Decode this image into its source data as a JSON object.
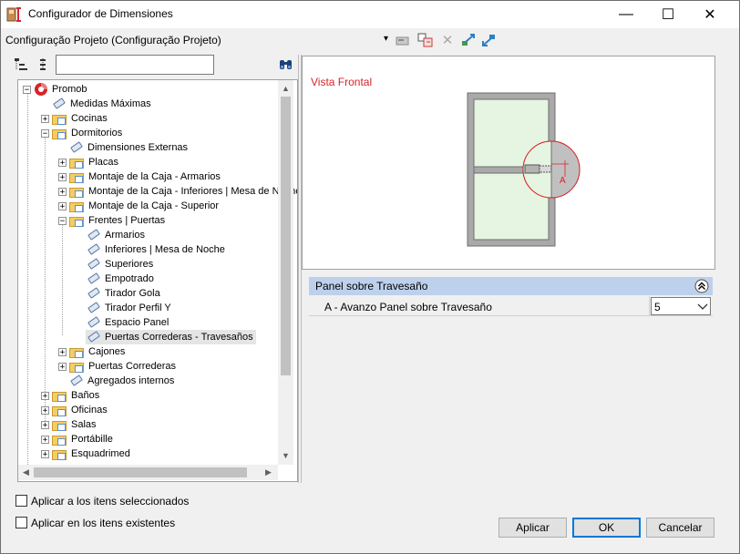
{
  "window": {
    "title": "Configurador de Dimensiones",
    "minimize": "—",
    "maximize": "☐",
    "close": "✕"
  },
  "config": {
    "label": "Configuração Projeto (Configuração Projeto)",
    "dropdown_glyph": "▾"
  },
  "search": {
    "value": "",
    "placeholder": ""
  },
  "tree": {
    "root": "Promob",
    "nodes": [
      "Medidas Máximas",
      "Cocinas",
      "Dormitorios",
      "Dimensiones Externas",
      "Placas",
      "Montaje de la Caja - Armarios",
      "Montaje de la Caja - Inferiores | Mesa de Noche",
      "Montaje de la Caja - Superior",
      "Frentes | Puertas",
      "Armarios",
      "Inferiores | Mesa de Noche",
      "Superiores",
      "Empotrado",
      "Tirador Gola",
      "Tirador Perfil Y",
      "Espacio Panel",
      "Puertas Correderas - Travesaños",
      "Cajones",
      "Puertas Correderas",
      "Agregados internos",
      "Baños",
      "Oficinas",
      "Salas",
      "Portábille",
      "Esquadrimed"
    ]
  },
  "preview": {
    "label": "Vista Frontal",
    "callout_letter": "A",
    "accent": "#d8232a"
  },
  "properties": {
    "section_title": "Panel sobre Travesaño",
    "rows": [
      {
        "label": "A - Avanzo Panel sobre Travesaño",
        "value": "5"
      }
    ]
  },
  "options": {
    "apply_selected": "Aplicar a los itens seleccionados",
    "apply_existing": "Aplicar en los itens existentes"
  },
  "buttons": {
    "apply": "Aplicar",
    "ok": "OK",
    "cancel": "Cancelar"
  }
}
